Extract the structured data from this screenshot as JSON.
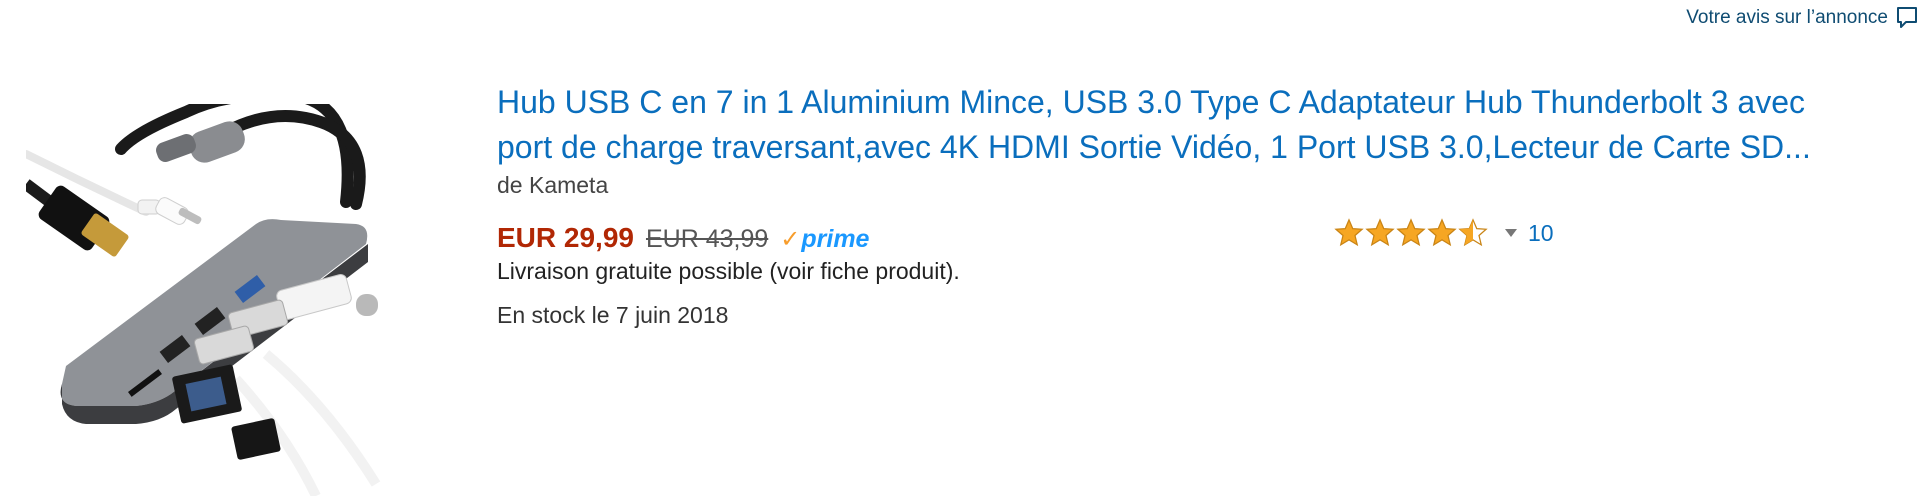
{
  "feedback": {
    "label": "Votre avis sur l’annonce",
    "icon": "speech-bubble-icon"
  },
  "product": {
    "title_line1": "Hub USB C en 7 in 1 Aluminium Mince, USB 3.0 Type C Adaptateur Hub Thunderbolt 3 avec",
    "title_line2": "port de charge traversant,avec 4K HDMI Sortie Vidéo, 1 Port USB 3.0,Lecteur de Carte SD...",
    "brand": "de Kameta",
    "price_current": "EUR 29,99",
    "price_old": "EUR 43,99",
    "prime_label": "prime",
    "delivery": "Livraison gratuite possible (voir fiche produit).",
    "stock": "En stock le 7 juin 2018",
    "rating": {
      "stars": 4.5,
      "max": 5,
      "count": "10"
    }
  },
  "colors": {
    "title_link": "#0a6ebd",
    "price": "#b12704",
    "prime_blue": "#1a98ff",
    "prime_check": "#f79d2c",
    "star_fill": "#f6a623"
  },
  "icons": {
    "prime_check": "checkmark-icon",
    "rating_dropdown": "caret-down-icon",
    "product_image": "usb-c-hub-image"
  }
}
